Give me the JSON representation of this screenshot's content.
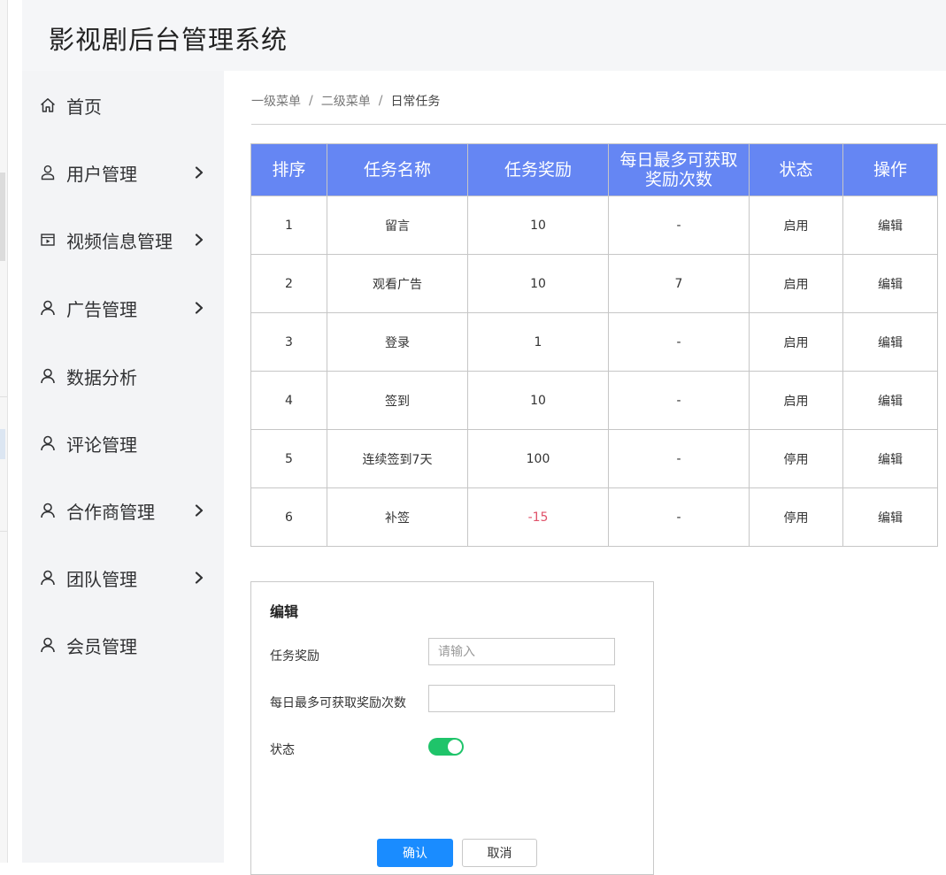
{
  "app": {
    "title": "影视剧后台管理系统"
  },
  "sidebar": {
    "items": [
      {
        "label": "首页",
        "icon": "home-icon",
        "has_arrow": false
      },
      {
        "label": "用户管理",
        "icon": "user-icon",
        "has_arrow": true
      },
      {
        "label": "视频信息管理",
        "icon": "video-icon",
        "has_arrow": true
      },
      {
        "label": "广告管理",
        "icon": "user-icon",
        "has_arrow": true
      },
      {
        "label": "数据分析",
        "icon": "user-icon",
        "has_arrow": false
      },
      {
        "label": "评论管理",
        "icon": "user-icon",
        "has_arrow": false
      },
      {
        "label": "合作商管理",
        "icon": "user-icon",
        "has_arrow": true
      },
      {
        "label": "团队管理",
        "icon": "user-icon",
        "has_arrow": true
      },
      {
        "label": "会员管理",
        "icon": "user-icon",
        "has_arrow": false
      }
    ]
  },
  "breadcrumb": {
    "items": [
      "一级菜单",
      "二级菜单",
      "日常任务"
    ],
    "separator": "/"
  },
  "table": {
    "headers": [
      "排序",
      "任务名称",
      "任务奖励",
      "每日最多可获取奖励次数",
      "状态",
      "操作"
    ],
    "rows": [
      [
        "1",
        "留言",
        "10",
        "-",
        "启用",
        "编辑"
      ],
      [
        "2",
        "观看广告",
        "10",
        "7",
        "启用",
        "编辑"
      ],
      [
        "3",
        "登录",
        "1",
        "-",
        "启用",
        "编辑"
      ],
      [
        "4",
        "签到",
        "10",
        "-",
        "启用",
        "编辑"
      ],
      [
        "5",
        "连续签到7天",
        "100",
        "-",
        "停用",
        "编辑"
      ],
      [
        "6",
        "补签",
        "-15",
        "-",
        "停用",
        "编辑"
      ]
    ]
  },
  "edit_form": {
    "title": "编辑",
    "reward_label": "任务奖励",
    "reward_placeholder": "请输入",
    "reward_value": "",
    "max_times_label": "每日最多可获取奖励次数",
    "max_times_value": "",
    "status_label": "状态",
    "status_on": true,
    "confirm_label": "确认",
    "cancel_label": "取消"
  },
  "colors": {
    "table_header": "#6586f3",
    "negative_value": "#e0526a",
    "toggle_on": "#1fc46a",
    "primary_button": "#1a8cff"
  }
}
